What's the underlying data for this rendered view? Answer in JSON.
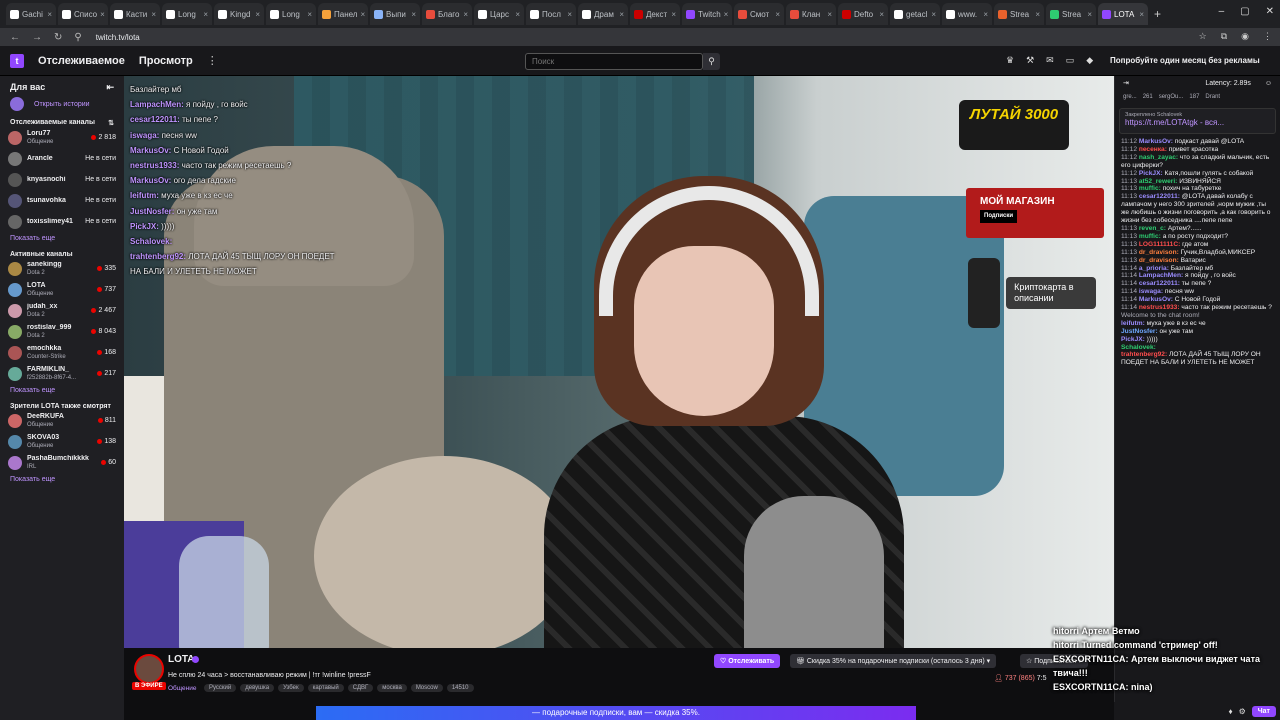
{
  "browser": {
    "tabs": [
      "Gachi",
      "Списо",
      "Касти",
      "Long",
      "Kingd",
      "Long",
      "Панел",
      "Выпи",
      "Благо",
      "Царс",
      "Посл",
      "Драм",
      "Декст",
      "Twitch",
      "Смот",
      "Клан",
      "Defto",
      "getacl",
      "www.",
      "Strea",
      "Strea",
      "LOTA"
    ],
    "tab_colors": [
      "#fff",
      "#fff",
      "#fff",
      "#fff",
      "#fff",
      "#fff",
      "#f6a23b",
      "#8ab4f8",
      "#e74c3c",
      "#fff",
      "#fff",
      "#fff",
      "#c00",
      "#9147ff",
      "#e74c3c",
      "#e74c3c",
      "#c00",
      "#fff",
      "#fff",
      "#e8612c",
      "#2ecc71",
      "#9147ff"
    ],
    "url": "twitch.tv/lota"
  },
  "topnav": {
    "following": "Отслеживаемое",
    "browse": "Просмотр",
    "search_placeholder": "Поиск",
    "prime": "Попробуйте один месяц без рекламы"
  },
  "sidebar": {
    "for_you": "Для вас",
    "history": "Открыть истории",
    "followed_title": "Отслеживаемые каналы",
    "followed": [
      {
        "name": "Loru77",
        "game": "Общение",
        "status": "2 818",
        "live": true
      },
      {
        "name": "Arancle",
        "game": "",
        "status": "Не в сети",
        "live": false
      },
      {
        "name": "knyasnochi",
        "game": "",
        "status": "Не в сети",
        "live": false
      },
      {
        "name": "tsunavohka",
        "game": "",
        "status": "Не в сети",
        "live": false
      },
      {
        "name": "toxisslimey41",
        "game": "",
        "status": "Не в сети",
        "live": false
      }
    ],
    "show_more_1": "Показать еще",
    "active_title": "Активные каналы",
    "active": [
      {
        "name": "sanekingg",
        "game": "Dota 2",
        "status": "335"
      },
      {
        "name": "LOTA",
        "game": "Общение",
        "status": "737"
      },
      {
        "name": "judah_xx",
        "game": "Dota 2",
        "status": "2 467"
      },
      {
        "name": "rostislav_999",
        "game": "Dota 2",
        "status": "8 043"
      },
      {
        "name": "emochkka",
        "game": "Counter-Strike",
        "status": "168"
      },
      {
        "name": "FARMIKLIN_",
        "game": "f252882b-8f67-4...",
        "status": "217"
      }
    ],
    "show_more_2": "Показать еще",
    "also_title": "Зрители LOTA также смотрят",
    "also": [
      {
        "name": "DeeRKUFA",
        "game": "Общение",
        "status": "811"
      },
      {
        "name": "SKOVA03",
        "game": "Общение",
        "status": "138"
      },
      {
        "name": "PashaBumchikkkk",
        "game": "IRL",
        "status": "60"
      }
    ],
    "show_more_3": "Показать еще"
  },
  "video_overlays": {
    "lutai": "ЛУТАЙ 3000",
    "shop": "МОЙ МАГАЗИН",
    "shop_sub": "Подписки",
    "card": "Криптокарта в описании"
  },
  "video_chat": [
    {
      "u": "",
      "t": "Базлайтер мб"
    },
    {
      "u": "LampachMen:",
      "t": "я пойду , го войс"
    },
    {
      "u": "cesar122011:",
      "t": "ты пепе ?"
    },
    {
      "u": "iswaga:",
      "t": "песня ww"
    },
    {
      "u": "MarkusOv:",
      "t": "С Новой Годой"
    },
    {
      "u": "nestrus1933:",
      "t": "часто так режим ресетаешь ?"
    },
    {
      "u": "MarkusOv:",
      "t": "ого дела гадские"
    },
    {
      "u": "leifutm:",
      "t": "муха уже в кз ес че"
    },
    {
      "u": "JustNosfer:",
      "t": "он уже там"
    },
    {
      "u": "PickJX:",
      "t": ")))))"
    },
    {
      "u": "Schalovek:",
      "t": ""
    },
    {
      "u": "trahtenberg92:",
      "t": "ЛОТА ДАЙ 45 ТЫЩ ЛОРУ ОН ПОЕДЕТ НА БАЛИ И УЛЕТЕТЬ НЕ МОЖЕТ"
    }
  ],
  "info": {
    "channel": "LOTA",
    "live_badge": "В ЭФИРЕ",
    "title": "Не сплю 24 часа > восстанавливаю режим | !тг !winline !pressF",
    "category": "Общение",
    "tags": [
      "Русский",
      "девушка",
      "Узбек",
      "картавый",
      "СДВГ",
      "москва",
      "Moscow",
      "14510"
    ],
    "follow": "Отслеживать",
    "gift": "Скидка 35% на подарочные подписки (осталось 3 дня)",
    "subscribe": "Подписаться",
    "viewers": "737 (865)",
    "uptime": "7:5"
  },
  "promo": "— подарочные подписки, вам — скидка 35%.",
  "chat": {
    "latency": "Latency: 2.89s",
    "leaders": [
      "gre...",
      "261",
      "sergOu...",
      "187",
      "Drant"
    ],
    "pinned_label": "Закреплено Schalovek",
    "pinned_text": "https://t.me/LOTAtgk - вся...",
    "messages": [
      {
        "ts": "11:12",
        "nm": "MarkusOv:",
        "c": "#9b8cff",
        "t": "подкаст давай @LOTA"
      },
      {
        "ts": "11:12",
        "nm": "песенка:",
        "c": "#ff4d4d",
        "t": "привет красотка"
      },
      {
        "ts": "11:12",
        "nm": "nash_zayac:",
        "c": "#2ecc71",
        "t": "что за сладкий мальчик, есть его циферки?"
      },
      {
        "ts": "11:12",
        "nm": "PickJX:",
        "c": "#9b8cff",
        "t": "Катя,пошли гулять с собакой"
      },
      {
        "ts": "11:13",
        "nm": "at52_reweri:",
        "c": "#2ecc71",
        "t": "ИЗВИНЯЙСЯ"
      },
      {
        "ts": "11:13",
        "nm": "muffic:",
        "c": "#2ecc71",
        "t": "похич на табуретке"
      },
      {
        "ts": "11:13",
        "nm": "cesar122011:",
        "c": "#9b8cff",
        "t": "@LOTA давай колабу с лампачом у него 300 зрителей ,норм мужик ,ты же любишь о жизни поговорить ,а как говорить о жизни без собеседника ....пепе пепе"
      },
      {
        "ts": "11:13",
        "nm": "reven_c:",
        "c": "#2ecc71",
        "t": "Артем?......"
      },
      {
        "ts": "11:13",
        "nm": "muffic:",
        "c": "#2ecc71",
        "t": "а по росту подходит?"
      },
      {
        "ts": "11:13",
        "nm": "LOG111111C:",
        "c": "#ff4d4d",
        "t": "где атом"
      },
      {
        "ts": "11:13",
        "nm": "dr_dravison:",
        "c": "#ff7f3f",
        "t": "Гучик,Владбой,МИКСЕР"
      },
      {
        "ts": "11:13",
        "nm": "dr_dravison:",
        "c": "#ff7f3f",
        "t": "Ватарис"
      },
      {
        "ts": "11:14",
        "nm": "a_prioria:",
        "c": "#9b8cff",
        "t": "Базлайтер мб"
      },
      {
        "ts": "11:14",
        "nm": "LampachMen:",
        "c": "#9b8cff",
        "t": "я пойду , го войс"
      },
      {
        "ts": "11:14",
        "nm": "cesar122011:",
        "c": "#9b8cff",
        "t": "ты пепе ?"
      },
      {
        "ts": "11:14",
        "nm": "iswaga:",
        "c": "#9b8cff",
        "t": "песня ww"
      },
      {
        "ts": "11:14",
        "nm": "MarkusOv:",
        "c": "#9b8cff",
        "t": "С Новой Годой"
      },
      {
        "ts": "11:14",
        "nm": "nestrus1933:",
        "c": "#ff4d4d",
        "t": "часто так режим ресетаешь ?"
      },
      {
        "ts": "",
        "nm": "",
        "c": "#adadb8",
        "t": "Welcome to the chat room!"
      },
      {
        "ts": "",
        "nm": "leifutm:",
        "c": "#9b8cff",
        "t": "муха уже в кз ес че"
      },
      {
        "ts": "",
        "nm": "JustNosfer:",
        "c": "#6ea8ff",
        "t": "он уже там"
      },
      {
        "ts": "",
        "nm": "PickJX:",
        "c": "#9b8cff",
        "t": ")))))"
      },
      {
        "ts": "",
        "nm": "Schalovek:",
        "c": "#2ecc71",
        "t": ""
      },
      {
        "ts": "",
        "nm": "trahtenberg92:",
        "c": "#ff4d4d",
        "t": "ЛОТА ДАЙ 45 ТЫЩ ЛОРУ ОН ПОЕДЕТ НА БАЛИ И УЛЕТЕТЬ НЕ МОЖЕТ"
      }
    ],
    "overlay_lines": [
      "hitorri Артем Ветмо",
      "hitorri Turned command 'стример' off!",
      "ESXCORTN11CA: Артем выключи виджет чата твича!!!",
      "ESXCORTN11CA: nina)"
    ],
    "chat_button": "Чат"
  }
}
